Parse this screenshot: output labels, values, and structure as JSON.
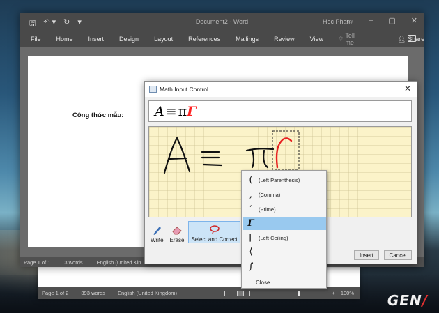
{
  "word": {
    "doc_title": "Document2 - Word",
    "user": "Hoc Pham",
    "ribbon_tabs": [
      "File",
      "Home",
      "Insert",
      "Design",
      "Layout",
      "References",
      "Mailings",
      "Review",
      "View"
    ],
    "tell_me": "Tell me",
    "share": "Share",
    "document_text": "Công thức mẫu:",
    "status": {
      "page": "Page 1 of 1",
      "words": "3 words",
      "language": "English (United Kin"
    }
  },
  "word2": {
    "status": {
      "page": "Page 1 of 2",
      "words": "393 words",
      "language": "English (United Kingdom)",
      "zoom": "100%"
    }
  },
  "dialog": {
    "title": "Math Input Control",
    "close": "✕",
    "preview": {
      "lhs": "A",
      "op": "≡",
      "pi": "π",
      "gamma": "Γ"
    },
    "tools": {
      "write": "Write",
      "erase": "Erase",
      "select_correct": "Select and Correct",
      "clear_partial": "C"
    },
    "insert": "Insert",
    "cancel": "Cancel"
  },
  "menu": {
    "items": [
      {
        "glyph": "(",
        "label": "(Left Parenthesis)"
      },
      {
        "glyph": ",",
        "label": "(Comma)"
      },
      {
        "glyph": "′",
        "label": "(Prime)"
      },
      {
        "glyph": "Γ",
        "label": ""
      },
      {
        "glyph": "⌈",
        "label": "(Left Ceiling)"
      },
      {
        "glyph": "⟨",
        "label": ""
      },
      {
        "glyph": "∫",
        "label": ""
      }
    ],
    "close": "Close"
  },
  "brand": {
    "logo_main": "GEN",
    "logo_mark": "/"
  },
  "colors": {
    "accent_red": "#ff2020",
    "highlight": "#99c9ef",
    "ink": "#111111",
    "writing_bg": "#fbf3c9"
  }
}
